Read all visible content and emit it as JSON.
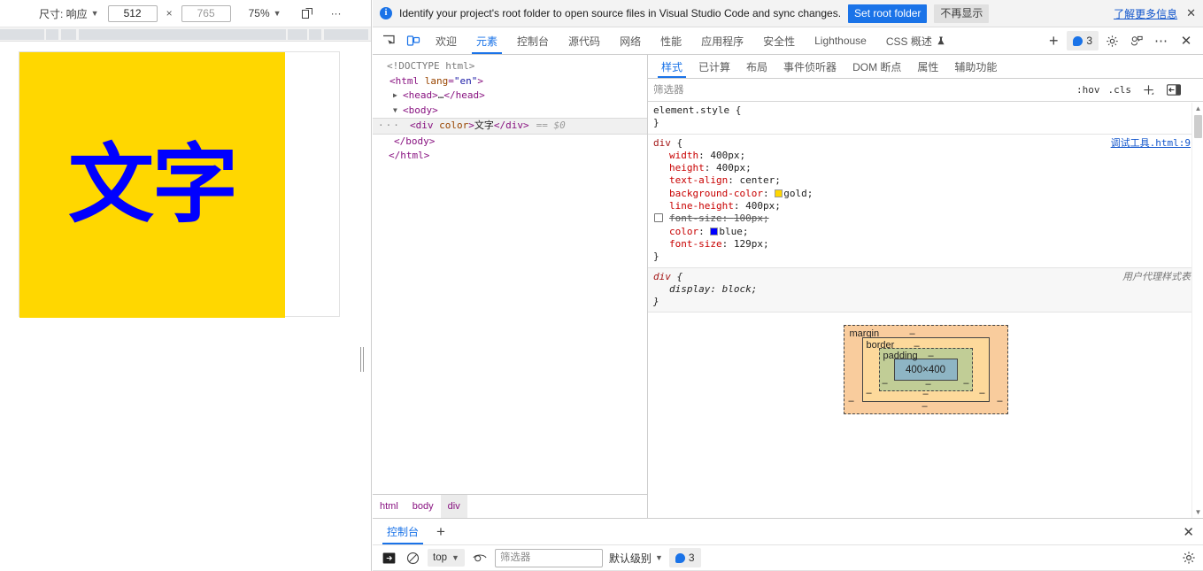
{
  "device_toolbar": {
    "size_label": "尺寸: 响应",
    "width_value": "512",
    "height_value": "765",
    "multiply": "×",
    "zoom_label": "75%",
    "more_label": "···",
    "rotate_icon": "rotate-icon",
    "caret": "▼"
  },
  "page_preview": {
    "div_text": "文字",
    "background_color": "gold",
    "text_color": "blue"
  },
  "infobar": {
    "icon": "info-icon",
    "message": "Identify your project's root folder to open source files in Visual Studio Code and sync changes.",
    "primary_button": "Set root folder",
    "secondary_button": "不再显示",
    "link": "了解更多信息",
    "close": "✕",
    "primary_color": "#1a73e8"
  },
  "tabstrip": {
    "left_icons": [
      {
        "name": "inspect-element-icon"
      },
      {
        "name": "device-toolbar-icon"
      }
    ],
    "tabs": [
      {
        "label": "欢迎",
        "active": false
      },
      {
        "label": "元素",
        "active": true
      },
      {
        "label": "控制台",
        "active": false
      },
      {
        "label": "源代码",
        "active": false
      },
      {
        "label": "网络",
        "active": false
      },
      {
        "label": "性能",
        "active": false
      },
      {
        "label": "应用程序",
        "active": false
      },
      {
        "label": "安全性",
        "active": false
      },
      {
        "label": "Lighthouse",
        "active": false
      },
      {
        "label": "CSS 概述",
        "active": false,
        "suffix_icon": "experiment-flask-icon"
      }
    ],
    "add_tab": "+",
    "issues_count": "3",
    "right_icons": [
      {
        "name": "settings-gear-icon"
      },
      {
        "name": "customize-devtools-icon"
      },
      {
        "name": "more-options-icon"
      },
      {
        "name": "close-devtools-icon"
      }
    ]
  },
  "dom_tree": {
    "lines": [
      {
        "indent": 0,
        "type": "doctype",
        "text": "<!DOCTYPE html>"
      },
      {
        "indent": 1,
        "type": "open",
        "tag": "html",
        "attr": "lang",
        "value": "\"en\""
      },
      {
        "indent": 2,
        "type": "collapsed",
        "tag": "head",
        "arrow": "▶"
      },
      {
        "indent": 2,
        "type": "open",
        "tag": "body",
        "arrow": "▼"
      },
      {
        "indent": 3,
        "type": "selected",
        "tag": "div",
        "attr": "color",
        "text": "文字",
        "marker": "== $0",
        "dots": "···"
      },
      {
        "indent": 2,
        "type": "close",
        "tag": "body"
      },
      {
        "indent": 1,
        "type": "close",
        "tag": "html"
      }
    ]
  },
  "breadcrumbs": [
    {
      "label": "html",
      "active": false
    },
    {
      "label": "body",
      "active": false
    },
    {
      "label": "div",
      "active": true
    }
  ],
  "styles_pane": {
    "tabs": [
      {
        "label": "样式",
        "active": true
      },
      {
        "label": "已计算",
        "active": false
      },
      {
        "label": "布局",
        "active": false
      },
      {
        "label": "事件侦听器",
        "active": false
      },
      {
        "label": "DOM 断点",
        "active": false
      },
      {
        "label": "属性",
        "active": false
      },
      {
        "label": "辅助功能",
        "active": false
      }
    ],
    "filter_placeholder": "筛选器",
    "filter_value": "",
    "hov": ":hov",
    "cls": ".cls",
    "new_rule_icon": "add-style-rule-icon",
    "toggle_sidebar_icon": "toggle-element-state-icon"
  },
  "rules": [
    {
      "selector": "element.style",
      "origin": "",
      "origin_link": false,
      "ua": false,
      "declarations": []
    },
    {
      "selector": "div",
      "origin": "调试工具.html:9",
      "origin_link": true,
      "ua": false,
      "declarations": [
        {
          "name": "width",
          "value": "400px",
          "disabled": false,
          "swatch": ""
        },
        {
          "name": "height",
          "value": "400px",
          "disabled": false,
          "swatch": ""
        },
        {
          "name": "text-align",
          "value": "center",
          "disabled": false,
          "swatch": ""
        },
        {
          "name": "background-color",
          "value": "gold",
          "disabled": false,
          "swatch": "#ffd700"
        },
        {
          "name": "line-height",
          "value": "400px",
          "disabled": false,
          "swatch": ""
        },
        {
          "name": "font-size",
          "value": "100px",
          "disabled": true,
          "swatch": ""
        },
        {
          "name": "color",
          "value": "blue",
          "disabled": false,
          "swatch": "#0000ff"
        },
        {
          "name": "font-size",
          "value": "129px",
          "disabled": false,
          "swatch": ""
        }
      ]
    },
    {
      "selector": "div",
      "origin": "用户代理样式表",
      "origin_link": false,
      "ua": true,
      "declarations": [
        {
          "name": "display",
          "value": "block",
          "disabled": false,
          "swatch": ""
        }
      ]
    }
  ],
  "box_model": {
    "margin_label": "margin",
    "border_label": "border",
    "padding_label": "padding",
    "content_size": "400×400",
    "dash": "–",
    "colors": {
      "margin": "#f9cc9d",
      "border": "#fdd99b",
      "padding": "#c1cd96",
      "content": "#8eb5c4"
    }
  },
  "drawer": {
    "tabs": [
      {
        "label": "控制台",
        "active": true
      }
    ],
    "add_tab": "+",
    "close": "✕",
    "toolbar": {
      "sidebar_icon": "console-sidebar-icon",
      "clear_icon": "clear-console-icon",
      "context_label": "top",
      "eye_icon": "live-expression-icon",
      "filter_placeholder": "筛选器",
      "filter_value": "",
      "level_label": "默认级别",
      "issues_count": "3",
      "settings_icon": "console-settings-icon",
      "caret": "▼"
    }
  }
}
